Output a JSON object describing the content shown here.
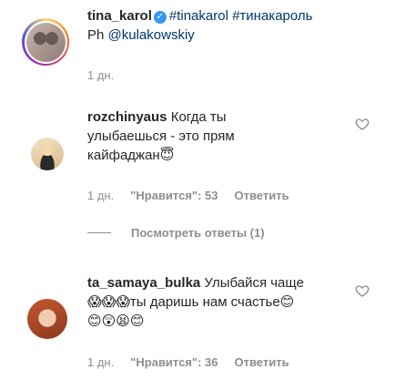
{
  "post": {
    "username": "tina_karol",
    "hashtag1": "#tinakarol",
    "hashtag2": "#тинакароль",
    "caption_prefix": "Ph",
    "mention": "@kulakowskiy",
    "time": "1 дн."
  },
  "comments": [
    {
      "username": "rozchinyaus",
      "text": "Когда ты улыбаешься - это прям кайфаджан😇",
      "time": "1 дн.",
      "likes": "\"Нравится\": 53",
      "reply_label": "Ответить"
    },
    {
      "username": "ta_samaya_bulka",
      "text": "Улыбайся чаще😱😱😱ты даришь нам счастье😊😊😲😫😊",
      "time": "1 дн.",
      "likes": "\"Нравится\": 36",
      "reply_label": "Ответить"
    }
  ],
  "view_replies": "Посмотреть ответы (1)",
  "icons": {
    "verified": "verified-badge-icon",
    "heart": "heart-outline-icon"
  },
  "colors": {
    "link": "#00376b",
    "muted": "#8e8e8e",
    "verified": "#3897f0"
  }
}
